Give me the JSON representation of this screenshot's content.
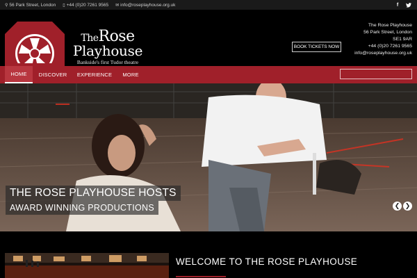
{
  "topbar": {
    "address": "56 Park Street, London",
    "phone": "+44 (0)20 7261 9565",
    "email": "info@roseplayhouse.org.uk",
    "social": [
      {
        "icon": "facebook-icon",
        "glyph": "f"
      },
      {
        "icon": "twitter-icon",
        "glyph": "🐦"
      }
    ]
  },
  "logo": {
    "line1_small": "The",
    "line1": "Rose",
    "line2": "Playhouse",
    "tagline": "Bankside's first Tudor theatre",
    "brand_color": "#a0202a"
  },
  "header": {
    "book_label": "BOOK TICKETS NOW",
    "address_lines": [
      "The Rose Playhouse",
      "56 Park Street, London",
      "SE1 9AR",
      "+44 (0)20 7261 9565",
      "info@roseplayhouse.org.uk"
    ]
  },
  "nav": {
    "items": [
      {
        "label": "HOME",
        "active": true
      },
      {
        "label": "DISCOVER",
        "active": false
      },
      {
        "label": "EXPERIENCE",
        "active": false
      },
      {
        "label": "MORE",
        "active": false
      }
    ],
    "search_placeholder": ""
  },
  "hero": {
    "caption_line1": "THE ROSE PLAYHOUSE HOSTS",
    "caption_line2": "AWARD WINNING PRODUCTIONS",
    "prev_glyph": "❮",
    "next_glyph": "❯"
  },
  "welcome": {
    "title": "WELCOME TO THE ROSE PLAYHOUSE"
  },
  "colors": {
    "nav_bg": "#a0202a",
    "topbar_bg": "#1a1a1a"
  }
}
